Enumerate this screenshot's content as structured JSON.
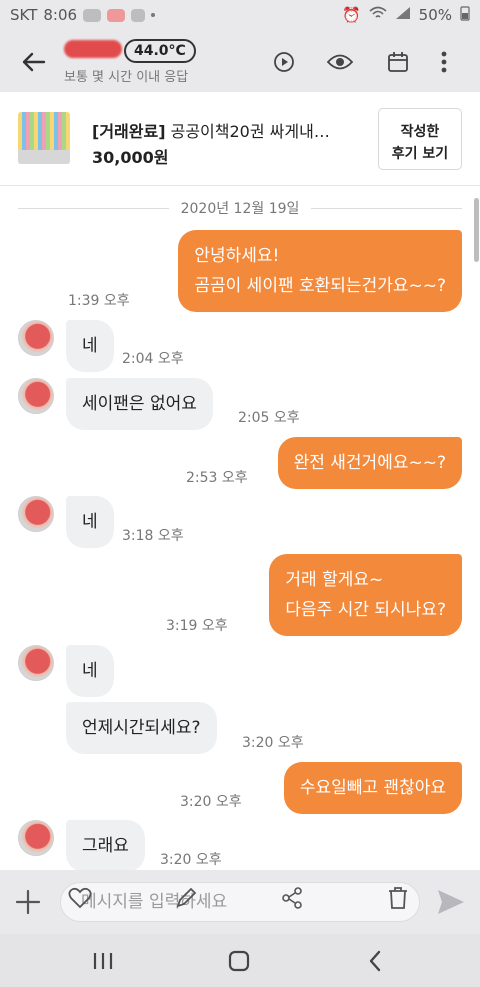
{
  "status_bar": {
    "carrier": "SKT",
    "time": "8:06",
    "battery": "50%"
  },
  "header": {
    "temperature": "44.0°C",
    "response_status": "보통 몇 시간 이내 응답"
  },
  "product": {
    "status_tag": "[거래완료]",
    "title": "공공이책20권 싸게내…",
    "price": "30,000원",
    "review_button": "작성한\n후기 보기"
  },
  "chat": {
    "date": "2020년 12월 19일",
    "messages": [
      {
        "side": "out",
        "lines": [
          "안녕하세요!",
          "곰곰이 세이팬 호환되는건가요~~?"
        ],
        "time": "1:39 오후"
      },
      {
        "side": "in",
        "text": "네",
        "time": "2:04 오후"
      },
      {
        "side": "in",
        "text": "세이팬은 없어요",
        "time": "2:05 오후"
      },
      {
        "side": "out",
        "text": "완전 새건거에요~~?",
        "time": "2:53 오후"
      },
      {
        "side": "in",
        "text": "네",
        "time": "3:18 오후"
      },
      {
        "side": "out",
        "lines": [
          "거래 할게요~",
          "다음주 시간 되시나요?"
        ],
        "time": "3:19 오후"
      },
      {
        "side": "in",
        "text": "네",
        "time": ""
      },
      {
        "side": "in",
        "text": "언제시간되세요?",
        "time": "3:20 오후"
      },
      {
        "side": "out",
        "text": "수요일빼고 괜찮아요",
        "time": "3:20 오후"
      },
      {
        "side": "in",
        "text": "그래요",
        "time": "3:20 오후"
      }
    ]
  },
  "input": {
    "placeholder": "메시지를 입력하세요"
  },
  "icons": {
    "back": "back-arrow-icon",
    "header_actions": [
      "video-call-icon",
      "eye-icon",
      "calendar-icon",
      "more-vertical-icon"
    ],
    "input_left": "plus-icon",
    "input_overlay": [
      "heart-icon",
      "pencil-icon",
      "share-icon",
      "trash-icon"
    ],
    "send": "send-icon",
    "nav": [
      "recent-apps-icon",
      "home-icon",
      "back-icon"
    ]
  },
  "colors": {
    "accent": "#f3893b",
    "incoming_bubble": "#eef0f2",
    "header_bg": "#e9e9ec"
  }
}
